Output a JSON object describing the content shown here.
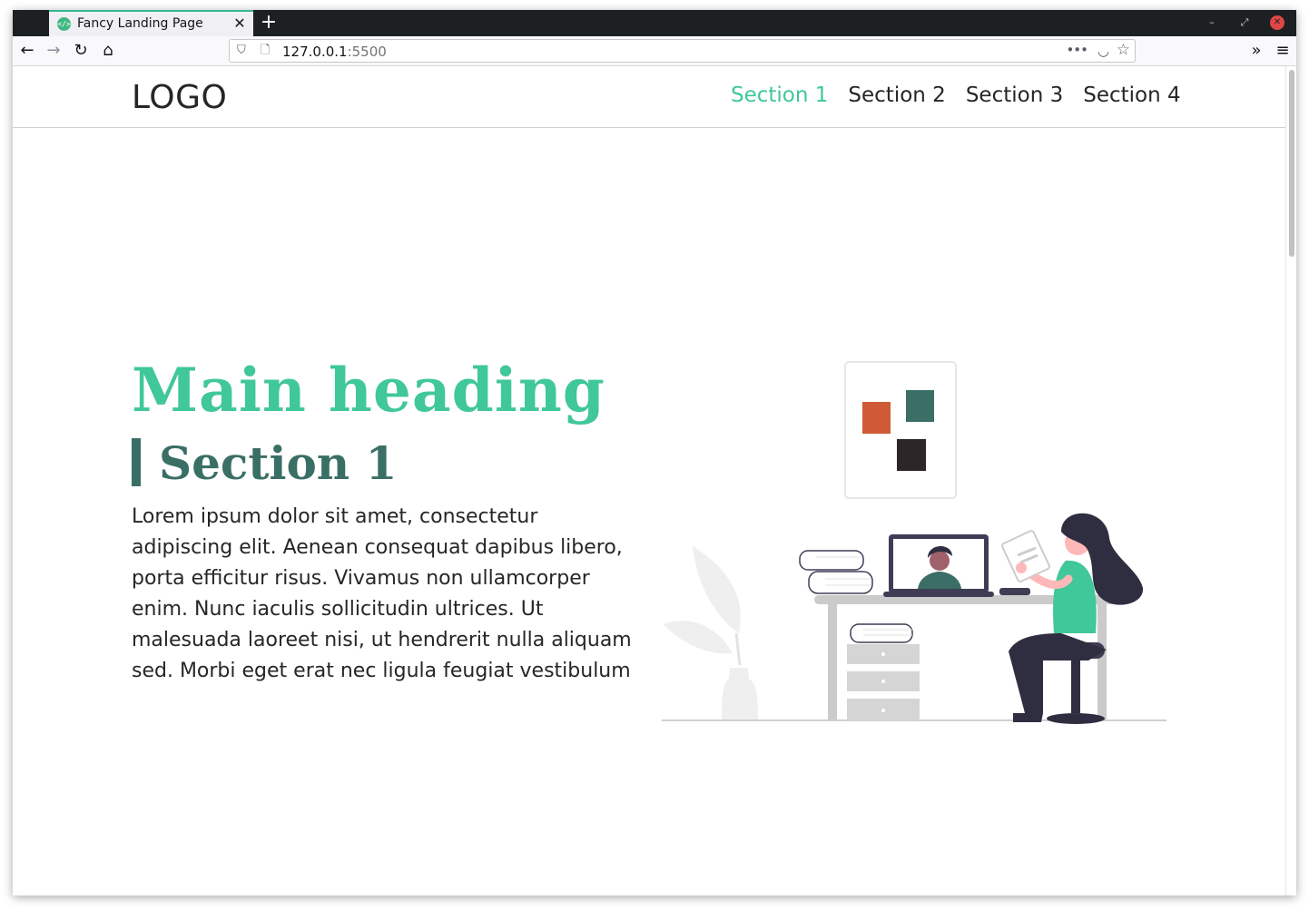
{
  "browser": {
    "tab_title": "Fancy Landing Page",
    "tab_favicon": "code-icon",
    "url_host": "127.0.0.1",
    "url_port": ":5500",
    "colors": {
      "chrome": "#1c2023",
      "tab_accent": "#35b78d"
    }
  },
  "site": {
    "logo": "LOGO",
    "nav": [
      {
        "label": "Section 1",
        "active": true
      },
      {
        "label": "Section 2",
        "active": false
      },
      {
        "label": "Section 3",
        "active": false
      },
      {
        "label": "Section 4",
        "active": false
      }
    ],
    "main_heading": "Main heading",
    "section_heading": "Section 1",
    "section_text": "Lorem ipsum dolor sit amet, consectetur adipiscing elit. Aenean consequat dapibus libero, porta efficitur risus. Vivamus non ullamcorper enim. Nunc iaculis sollicitudin ultrices. Ut malesuada laoreet nisi, ut hendrerit nulla aliquam sed. Morbi eget erat nec ligula feugiat vestibulum",
    "colors": {
      "accent": "#40c79a",
      "section_heading": "#3a6f66",
      "text": "#262626"
    }
  },
  "illustration": {
    "name": "woman-on-video-call-at-desk",
    "tile_colors": [
      "#cf5a36",
      "#3b6e66",
      "#2c2629"
    ]
  }
}
